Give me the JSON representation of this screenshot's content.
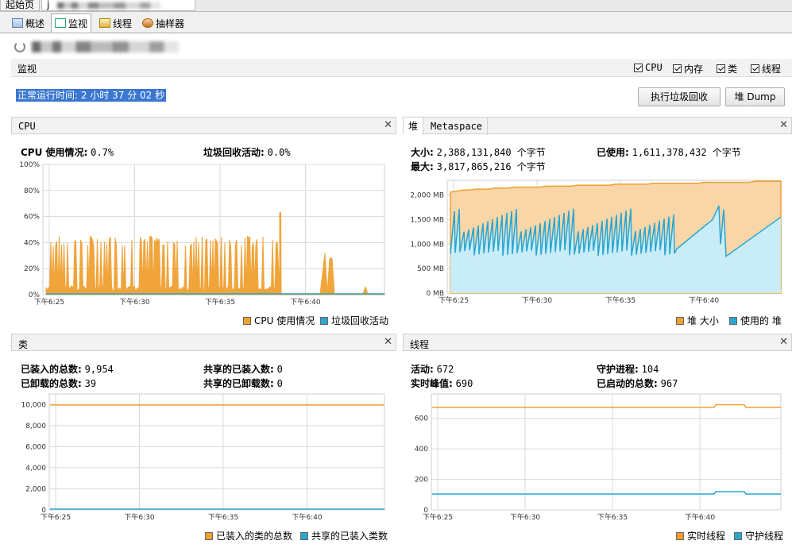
{
  "top_tabs": [
    "起始页",
    "j"
  ],
  "sub_tabs": [
    {
      "label": "概述",
      "icon": "overview-icon"
    },
    {
      "label": "监视",
      "icon": "monitor-icon"
    },
    {
      "label": "线程",
      "icon": "threads-icon"
    },
    {
      "label": "抽样器",
      "icon": "sampler-icon"
    }
  ],
  "monitor": {
    "title": "监视",
    "checks": [
      "CPU",
      "内存",
      "类",
      "线程"
    ],
    "uptime": "正常运行时间: 2 小时 37 分 02 秒",
    "gc_button": "执行垃圾回收",
    "dump_button": "堆 Dump"
  },
  "cpu_panel": {
    "title": "CPU",
    "usage_label": "CPU 使用情况:",
    "usage_value": "0.7%",
    "gc_label": "垃圾回收活动:",
    "gc_value": "0.0%",
    "legend": [
      "CPU 使用情况",
      "垃圾回收活动"
    ]
  },
  "heap_panel": {
    "tabs": [
      "堆",
      "Metaspace"
    ],
    "size_label": "大小:",
    "size_value": "2,388,131,840 个字节",
    "used_label": "已使用:",
    "used_value": "1,611,378,432 个字节",
    "max_label": "最大:",
    "max_value": "3,817,865,216 个字节",
    "legend": [
      "堆 大小",
      "使用的 堆"
    ]
  },
  "classes_panel": {
    "title": "类",
    "loaded_label": "已装入的总数:",
    "loaded_value": "9,954",
    "unloaded_label": "已卸载的总数:",
    "unloaded_value": "39",
    "shared_loaded_label": "共享的已装入数:",
    "shared_loaded_value": "0",
    "shared_unloaded_label": "共享的已卸载数:",
    "shared_unloaded_value": "0",
    "legend": [
      "已装入的类的总数",
      "共享的已装入类数"
    ]
  },
  "threads_panel": {
    "title": "线程",
    "live_label": "活动:",
    "live_value": "672",
    "peak_label": "实时峰值:",
    "peak_value": "690",
    "daemon_label": "守护进程:",
    "daemon_value": "104",
    "started_label": "已启动的总数:",
    "started_value": "967",
    "legend": [
      "实时线程",
      "守护线程"
    ]
  },
  "colors": {
    "orange": "#f0a030",
    "orange_fill": "#f8d6a8",
    "blue": "#2aa6d0",
    "blue_fill": "#c8ecf8",
    "grid": "#d9d9d9"
  },
  "chart_data": [
    {
      "type": "area",
      "title": "CPU",
      "x_ticks": [
        "下午6:25",
        "下午6:30",
        "下午6:35",
        "下午6:40"
      ],
      "y_ticks": [
        "0%",
        "20%",
        "40%",
        "60%",
        "80%",
        "100%"
      ],
      "ylim": [
        0,
        100
      ],
      "series": [
        {
          "name": "CPU 使用情况",
          "note_range": "oscillating 5%-45% from 6:24 to 6:38, spike 63% at 6:38, near 0 after, spikes 32% ~6:40, 6% ~6:42",
          "peaks": [
            {
              "x": "6:38",
              "y": 63
            },
            {
              "x": "6:40",
              "y": 32
            },
            {
              "x": "6:42",
              "y": 6
            }
          ],
          "typical_max": 45
        },
        {
          "name": "垃圾回收活动",
          "values": [
            0
          ]
        }
      ]
    },
    {
      "type": "area",
      "title": "堆",
      "x_ticks": [
        "下午6:25",
        "下午6:30",
        "下午6:35",
        "下午6:40"
      ],
      "y_ticks": [
        "0 MB",
        "500 MB",
        "1,000 MB",
        "1,500 MB",
        "2,000 MB"
      ],
      "ylim": [
        0,
        2300
      ],
      "series": [
        {
          "name": "堆 大小",
          "start": 2050,
          "end": 2280
        },
        {
          "name": "使用的 堆",
          "range": [
            750,
            1800
          ],
          "end": 1550
        }
      ]
    },
    {
      "type": "line",
      "title": "类",
      "x_ticks": [
        "下午6:25",
        "下午6:30",
        "下午6:35",
        "下午6:40"
      ],
      "y_ticks": [
        "0",
        "2,000",
        "4,000",
        "6,000",
        "8,000",
        "10,000"
      ],
      "ylim": [
        0,
        11000
      ],
      "series": [
        {
          "name": "已装入的类的总数",
          "value": 9954
        },
        {
          "name": "共享的已装入类数",
          "value": 0
        }
      ]
    },
    {
      "type": "line",
      "title": "线程",
      "x_ticks": [
        "下午6:25",
        "下午6:30",
        "下午6:35",
        "下午6:40"
      ],
      "y_ticks": [
        "0",
        "200",
        "400",
        "600"
      ],
      "ylim": [
        0,
        760
      ],
      "series": [
        {
          "name": "实时线程",
          "value": 672,
          "peak": 690
        },
        {
          "name": "守护线程",
          "value": 104,
          "peak": 120
        }
      ]
    }
  ]
}
